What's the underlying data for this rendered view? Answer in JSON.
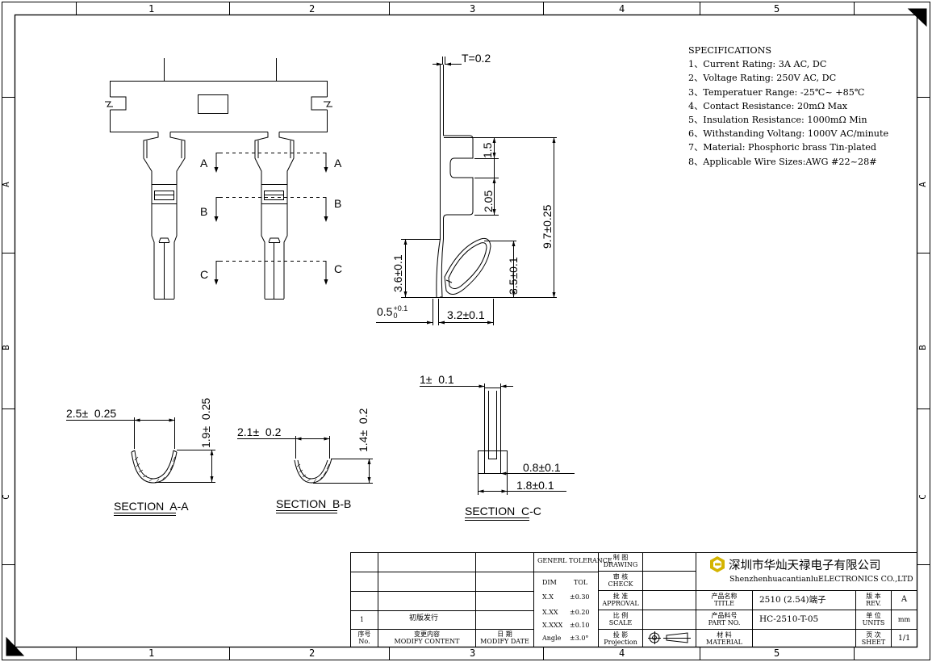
{
  "frame": {
    "col_labels": [
      "1",
      "2",
      "3",
      "4",
      "5"
    ],
    "row_labels": [
      "A",
      "B",
      "C"
    ]
  },
  "specifications": {
    "title": "SPECIFICATIONS",
    "items": [
      "1、Current Rating: 3A AC, DC",
      "2、Voltage Rating: 250V AC, DC",
      "3、Temperatuer Range: -25℃~ +85℃",
      "4、Contact Resistance: 20mΩ  Max",
      "5、Insulation Resistance: 1000mΩ   Min",
      "6、Withstanding  Voltang: 1000V AC/minute",
      "7、Material: Phosphoric brass Tin-plated",
      "8、Applicable Wire Sizes:AWG #22~28#"
    ]
  },
  "top_view": {
    "section_marks": [
      "A",
      "A",
      "B",
      "B",
      "C",
      "C"
    ]
  },
  "side_view": {
    "thickness": "T=0.2",
    "dim_1_5": "1.5",
    "dim_2_05": "2.05",
    "dim_height": "9.7±0.25",
    "dim_3_6": "3.6±0.1",
    "dim_3_5": "3.5±0.1",
    "dim_0_5": "0.5",
    "dim_0_5_tol_upper": "+0.1",
    "dim_0_5_tol_lower": "0",
    "dim_3_2": "3.2±0.1"
  },
  "section_aa": {
    "label": "SECTION  A-A",
    "width": "2.5±  0.25",
    "height": "1.9±  0.25"
  },
  "section_bb": {
    "label": "SECTION  B-B",
    "width": "2.1±  0.2",
    "height": "1.4±  0.2"
  },
  "section_cc": {
    "label": "SECTION  C-C",
    "dim_top": "1±  0.1",
    "dim_mid": "0.8±0.1",
    "dim_bot": "1.8±0.1"
  },
  "title_block": {
    "revision_no": "1",
    "revision_content": "初版发行",
    "col_no_cn": "序号",
    "col_no_en": "No.",
    "col_content_cn": "变更内容",
    "col_content_en": "MODIFY CONTENT",
    "col_date_cn": "日 期",
    "col_date_en": "MODIFY DATE",
    "tolerance_title": "GENERL TOLERANCE",
    "tol_head_dim": "DIM",
    "tol_head_tol": "TOL",
    "tol_rows": [
      {
        "dim": "X.X",
        "tol": "±0.30"
      },
      {
        "dim": "X.XX",
        "tol": "±0.20"
      },
      {
        "dim": "X.XXX",
        "tol": "±0.10"
      },
      {
        "dim": "Angle",
        "tol": "±3.0°"
      }
    ],
    "approval_rows": [
      {
        "cn": "制 图",
        "en": "DRAWING"
      },
      {
        "cn": "审 核",
        "en": "CHECK"
      },
      {
        "cn": "批 准",
        "en": "APPROVAL"
      },
      {
        "cn": "比 例",
        "en": "SCALE"
      },
      {
        "cn": "投 影",
        "en": "Projection"
      }
    ],
    "company_cn": "深圳市华灿天禄电子有限公司",
    "company_en": "ShenzhenhuacantianluELECTRONICS CO.,LTD",
    "title_label_cn": "产品名称",
    "title_label_en": "TITLE",
    "title_value": "2510 (2.54)端子",
    "part_label_cn": "产品料号",
    "part_label_en": "PART NO.",
    "part_value": "HC-2510-T-05",
    "material_label_cn": "材 料",
    "material_label_en": "MATERIAL",
    "rev_label_cn": "版 本",
    "rev_label_en": "REV.",
    "rev_value": "A",
    "units_label_cn": "单 位",
    "units_label_en": "UNITS",
    "units_value": "mm",
    "sheet_label_cn": "页 次",
    "sheet_label_en": "SHEET",
    "sheet_value": "1/1"
  },
  "colors": {
    "line": "#000000",
    "logo": "#d4b400"
  }
}
